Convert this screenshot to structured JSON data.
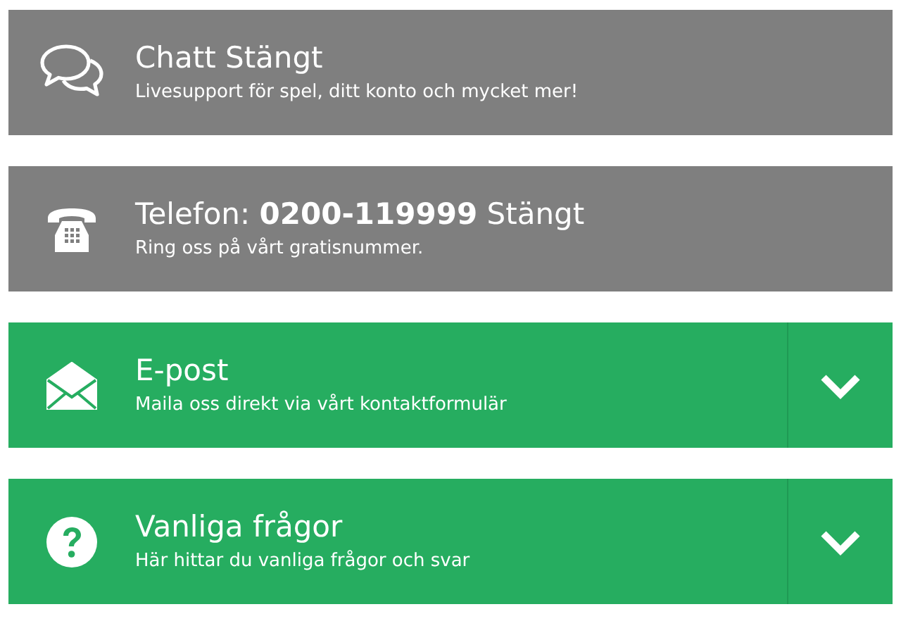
{
  "contact_options": [
    {
      "kind": "chat",
      "title": "Chatt Stängt",
      "subtitle": "Livesupport för spel, ditt konto och mycket mer!",
      "open": false
    },
    {
      "kind": "phone",
      "title": "Telefon: **0200-119999** Stängt",
      "subtitle": "Ring oss på vårt gratisnummer.",
      "open": false
    },
    {
      "kind": "email",
      "title": "E-post",
      "subtitle": "Maila oss direkt via vårt kontaktformulär",
      "open": true,
      "expanded": false
    },
    {
      "kind": "faq",
      "title": "Vanliga frågor",
      "subtitle": "Här hittar du vanliga frågor och svar",
      "open": true,
      "expanded": false
    }
  ]
}
